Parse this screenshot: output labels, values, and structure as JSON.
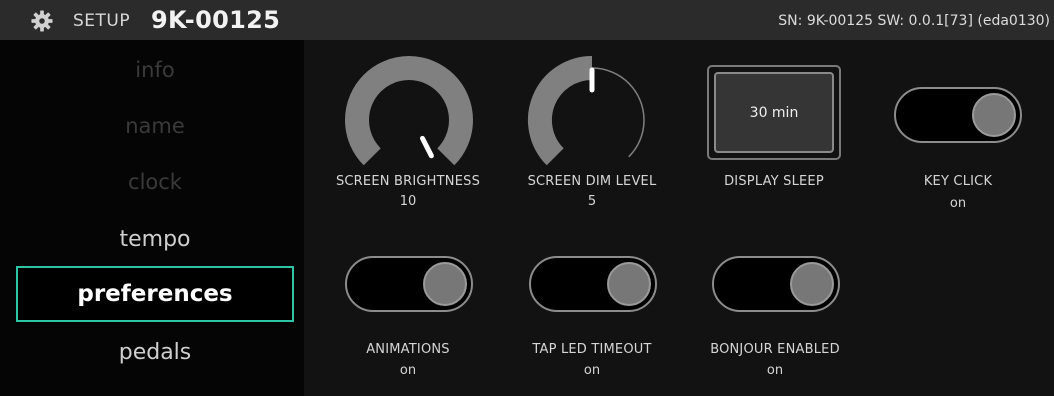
{
  "header": {
    "setup_label": "SETUP",
    "device_id": "9K-00125",
    "sn_info": "SN: 9K-00125 SW: 0.0.1[73] (eda0130)"
  },
  "sidebar": {
    "items": [
      {
        "label": "info",
        "state": "dim"
      },
      {
        "label": "name",
        "state": "dim"
      },
      {
        "label": "clock",
        "state": "dim"
      },
      {
        "label": "tempo",
        "state": "normal"
      },
      {
        "label": "preferences",
        "state": "selected"
      },
      {
        "label": "pedals",
        "state": "normal"
      }
    ]
  },
  "controls": {
    "screen_brightness": {
      "label": "SCREEN BRIGHTNESS",
      "value": "10"
    },
    "screen_dim_level": {
      "label": "SCREEN DIM LEVEL",
      "value": "5"
    },
    "display_sleep": {
      "label": "DISPLAY SLEEP",
      "value": "30 min"
    },
    "key_click": {
      "label": "KEY CLICK",
      "value": "on"
    },
    "animations": {
      "label": "ANIMATIONS",
      "value": "on"
    },
    "tap_led_timeout": {
      "label": "TAP LED TIMEOUT",
      "value": "on"
    },
    "bonjour_enabled": {
      "label": "BONJOUR ENABLED",
      "value": "on"
    }
  },
  "colors": {
    "accent": "#2ec4a6",
    "header_bg": "#2b2b2b",
    "panel_bg": "#121212",
    "knob_fill": "#808080"
  },
  "icons": {
    "header": "gear-icon"
  }
}
